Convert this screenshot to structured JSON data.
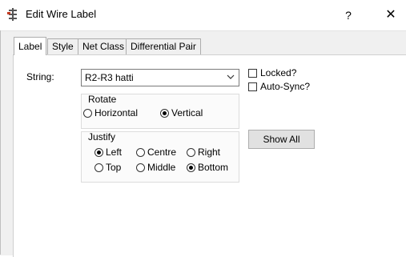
{
  "window": {
    "title": "Edit Wire Label",
    "help_label": "?",
    "close_label": "✕"
  },
  "tabs": [
    {
      "label": "Label",
      "active": true
    },
    {
      "label": "Style",
      "active": false
    },
    {
      "label": "Net Class",
      "active": false
    },
    {
      "label": "Differential Pair",
      "active": false
    }
  ],
  "form": {
    "string_label": "String:",
    "string_value": "R2-R3 hatti",
    "rotate": {
      "title": "Rotate",
      "options": [
        {
          "label": "Horizontal",
          "selected": false
        },
        {
          "label": "Vertical",
          "selected": true
        }
      ]
    },
    "justify": {
      "title": "Justify",
      "options": [
        {
          "label": "Left",
          "selected": true
        },
        {
          "label": "Centre",
          "selected": false
        },
        {
          "label": "Right",
          "selected": false
        },
        {
          "label": "Top",
          "selected": false
        },
        {
          "label": "Middle",
          "selected": false
        },
        {
          "label": "Bottom",
          "selected": true
        }
      ]
    },
    "locked_label": "Locked?",
    "locked_checked": false,
    "autosync_label": "Auto-Sync?",
    "autosync_checked": false,
    "show_all_label": "Show All"
  }
}
